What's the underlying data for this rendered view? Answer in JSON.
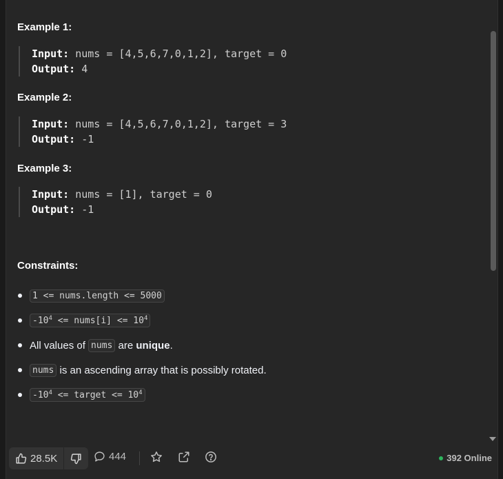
{
  "examples": [
    {
      "title": "Example 1:",
      "input_label": "Input:",
      "input_value": "nums = [4,5,6,7,0,1,2], target = 0",
      "output_label": "Output:",
      "output_value": "4"
    },
    {
      "title": "Example 2:",
      "input_label": "Input:",
      "input_value": "nums = [4,5,6,7,0,1,2], target = 3",
      "output_label": "Output:",
      "output_value": "-1"
    },
    {
      "title": "Example 3:",
      "input_label": "Input:",
      "input_value": "nums = [1], target = 0",
      "output_label": "Output:",
      "output_value": "-1"
    }
  ],
  "constraints": {
    "title": "Constraints:",
    "c1": "1 <= nums.length <= 5000",
    "c2": {
      "a": "-10",
      "a_exp": "4",
      "b": " <= nums[i] <= 10",
      "b_exp": "4"
    },
    "c3": {
      "pre": "All values of",
      "code": "nums",
      "mid": "are",
      "bold": "unique",
      "post": "."
    },
    "c4": {
      "code": "nums",
      "text": "is an ascending array that is possibly rotated."
    },
    "c5": {
      "a": "-10",
      "a_exp": "4",
      "b": " <= target <= 10",
      "b_exp": "4"
    }
  },
  "toolbar": {
    "likes": "28.5K",
    "comments": "444",
    "online": "392 Online"
  },
  "icons": [
    "thumbs-up-icon",
    "thumbs-down-icon",
    "comment-icon",
    "star-icon",
    "share-icon",
    "help-icon"
  ],
  "colors": {
    "background": "#262626",
    "online_dot": "#2db55d",
    "text": "#eff1f6"
  }
}
